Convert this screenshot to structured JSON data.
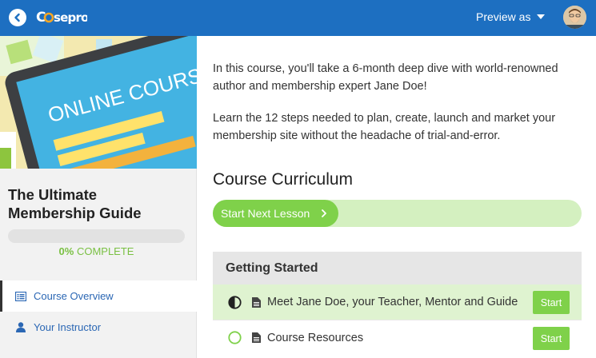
{
  "topbar": {
    "brand": "Caseproof",
    "preview_label": "Preview as",
    "colors": {
      "bar": "#1d6fc1",
      "accent": "#f6a623"
    }
  },
  "sidebar": {
    "hero_text": "ONLINE COURSES",
    "course_title": "The Ultimate Membership Guide",
    "progress": {
      "percent_value": 0,
      "percent_label": "0%",
      "label": "COMPLETE"
    },
    "nav": [
      {
        "label": "Course Overview",
        "icon": "list-icon",
        "active": true
      },
      {
        "label": "Your Instructor",
        "icon": "user-icon",
        "active": false
      }
    ]
  },
  "main": {
    "intro": [
      "In this course, you'll take a 6-month deep dive with world-renowned author and membership expert Jane Doe!",
      "Learn the 12 steps needed to plan, create, launch and market your membership site without the headache of trial-and-error."
    ],
    "curriculum_title": "Course Curriculum",
    "next_lesson_label": "Start Next Lesson",
    "sections": [
      {
        "title": "Getting Started",
        "lessons": [
          {
            "title": "Meet Jane Doe, your Teacher, Mentor and Guide",
            "status": "in-progress",
            "button": "Start"
          },
          {
            "title": "Course Resources",
            "status": "not-started",
            "button": "Start"
          }
        ]
      }
    ]
  },
  "colors": {
    "green": "#7fd14a",
    "green_light": "#d4f0c0",
    "link_blue": "#2b67b4"
  }
}
